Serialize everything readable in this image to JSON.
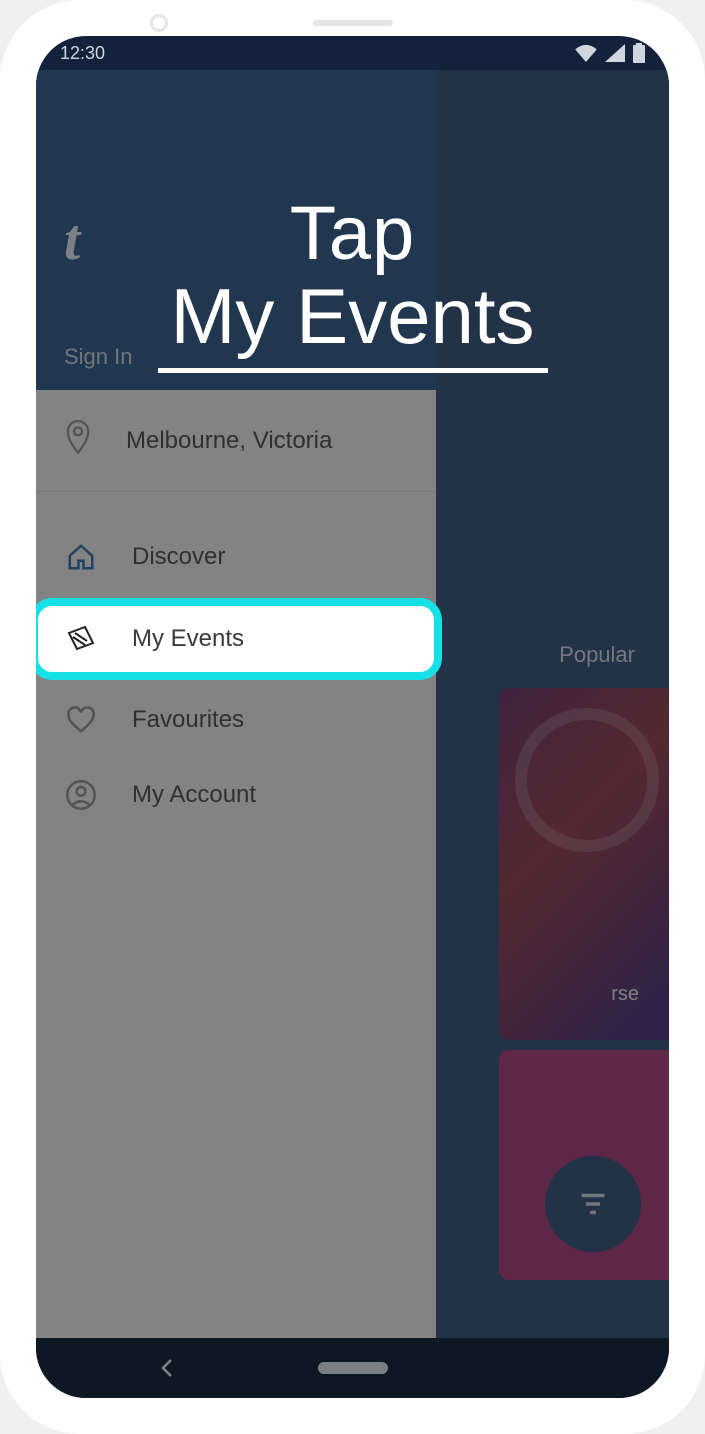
{
  "statusbar": {
    "time": "12:30"
  },
  "instruction": {
    "line1": "Tap",
    "line2": "My Events"
  },
  "drawer": {
    "logo": "t",
    "signin": "Sign In",
    "location": "Melbourne, Victoria",
    "items": [
      {
        "label": "Discover"
      },
      {
        "label": "My Events"
      },
      {
        "label": "Favourites"
      },
      {
        "label": "My Account"
      }
    ]
  },
  "background": {
    "tab_popular": "Popular",
    "card1_caption": "rse"
  }
}
